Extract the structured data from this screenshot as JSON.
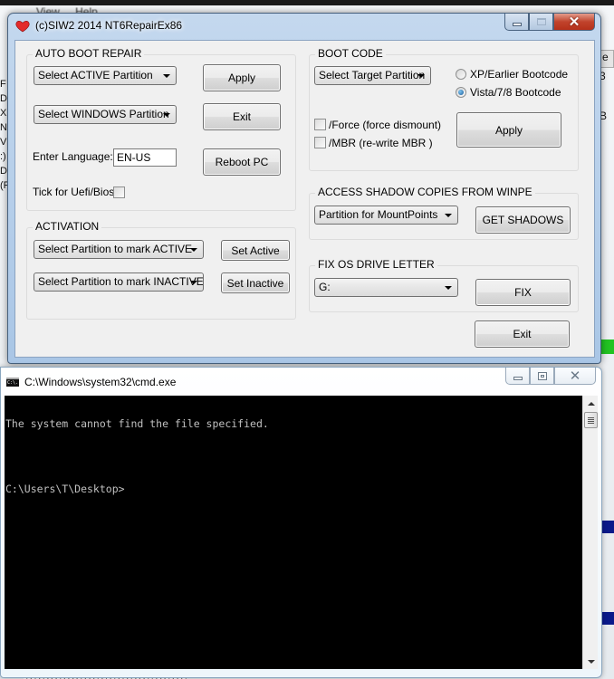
{
  "background": {
    "menu": [
      "View",
      "Help"
    ],
    "left_fragments": [
      "F",
      "D",
      "X:",
      "N:",
      "V",
      ":)",
      "D",
      "(F"
    ],
    "right_header": "e",
    "right_fragments": [
      "3",
      "B"
    ]
  },
  "repair_window": {
    "title": "(c)SIW2 2014 NT6RepairEx86",
    "caption": {
      "minimize": "minimize",
      "maximize": "maximize",
      "close": "close"
    },
    "auto_boot_repair": {
      "label": "AUTO BOOT REPAIR",
      "active_partition_combo": "Select ACTIVE Partition",
      "windows_partition_combo": "Select WINDOWS Partition",
      "apply_button": "Apply",
      "exit_button": "Exit",
      "language_label": "Enter Language:",
      "language_value": "EN-US",
      "reboot_button": "Reboot PC",
      "uefi_label": "Tick for Uefi/Bios",
      "uefi_checked": false
    },
    "activation": {
      "label": "ACTIVATION",
      "mark_active_combo": "Select Partition to mark ACTIVE",
      "mark_inactive_combo": "Select Partition to mark INACTIVE",
      "set_active_button": "Set Active",
      "set_inactive_button": "Set Inactive"
    },
    "boot_code": {
      "label": "BOOT CODE",
      "target_partition_combo": "Select Target Partition",
      "radio_xp": "XP/Earlier Bootcode",
      "radio_vista": "Vista/7/8 Bootcode",
      "selected_radio": "Vista/7/8 Bootcode",
      "force_label": "/Force (force dismount)",
      "force_checked": false,
      "mbr_label": "/MBR (re-write MBR )",
      "mbr_checked": false,
      "apply_button": "Apply"
    },
    "shadow_copies": {
      "label": "ACCESS SHADOW COPIES FROM WINPE",
      "mountpoints_combo": "Partition for MountPoints",
      "get_shadows_button": "GET SHADOWS"
    },
    "fix_drive_letter": {
      "label": "FIX OS DRIVE LETTER",
      "drive_combo": "G:",
      "fix_button": "FIX"
    },
    "exit_button": "Exit"
  },
  "cmd_window": {
    "icon_text": "C:\\.",
    "title": "C:\\Windows\\system32\\cmd.exe",
    "lines": [
      "The system cannot find the file specified.",
      "",
      "C:\\Users\\T\\Desktop>"
    ]
  }
}
